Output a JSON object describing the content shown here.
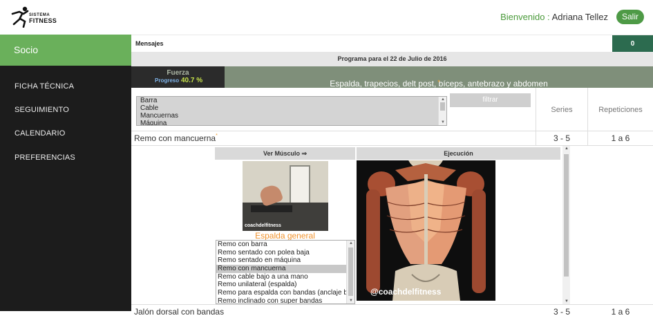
{
  "header": {
    "welcome_label": "Bienvenido :",
    "user_name": "Adriana Tellez",
    "logout_label": "Salir"
  },
  "logo": {
    "line1": "SISTEMA",
    "line2": "FITNESS"
  },
  "sidebar": {
    "title": "Socio",
    "items": [
      {
        "label": "FICHA TÉCNICA"
      },
      {
        "label": "SEGUIMIENTO"
      },
      {
        "label": "CALENDARIO"
      },
      {
        "label": "PREFERENCIAS"
      }
    ]
  },
  "messages": {
    "label": "Mensajes",
    "count": "0"
  },
  "program": {
    "title": "Programa para el 22 de Julio de 2016"
  },
  "phase": {
    "name": "Fuerza",
    "progress_label": "Progreso",
    "progress_value": "40.7 %"
  },
  "muscles": {
    "label": "Espalda, trapecios, delt post, bíceps, antebrazo y abdomen",
    "marker": "*"
  },
  "filter": {
    "options": [
      "Barra",
      "Cable",
      "Mancuernas",
      "Máquina"
    ],
    "button_label": "filtrar"
  },
  "columns": {
    "series": "Series",
    "repetitions": "Repeticiones"
  },
  "exercise": {
    "name": "Remo con mancuerna",
    "marker": "*",
    "series": "3 - 5",
    "repetitions": "1 a 6",
    "tabs": {
      "muscle": "Ver Músculo ⇒",
      "execution": "Ejecución"
    },
    "thumb_caption": "coachdelfitness",
    "group": "Espalda general",
    "alternatives": [
      "Remo con barra",
      "Remo sentado con polea baja",
      "Remo sentado en máquina",
      "Remo con mancuerna",
      "Remo cable bajo a una mano",
      "Remo unilateral (espalda)",
      "Remo para espalda con bandas (anclaje bajo)",
      "Remo inclinado con super bandas"
    ],
    "selected_alternative": "Remo con mancuerna",
    "image_caption": "@coachdelfitness"
  },
  "next_exercise": {
    "name": "Jalón dorsal con bandas",
    "series": "3 - 5",
    "repetitions": "1 a 6"
  },
  "colors": {
    "accent_green": "#6ab05b",
    "dark_sidebar": "#1c1c1c",
    "muscle_bar": "#7f8f7a",
    "orange": "#f0922c"
  }
}
